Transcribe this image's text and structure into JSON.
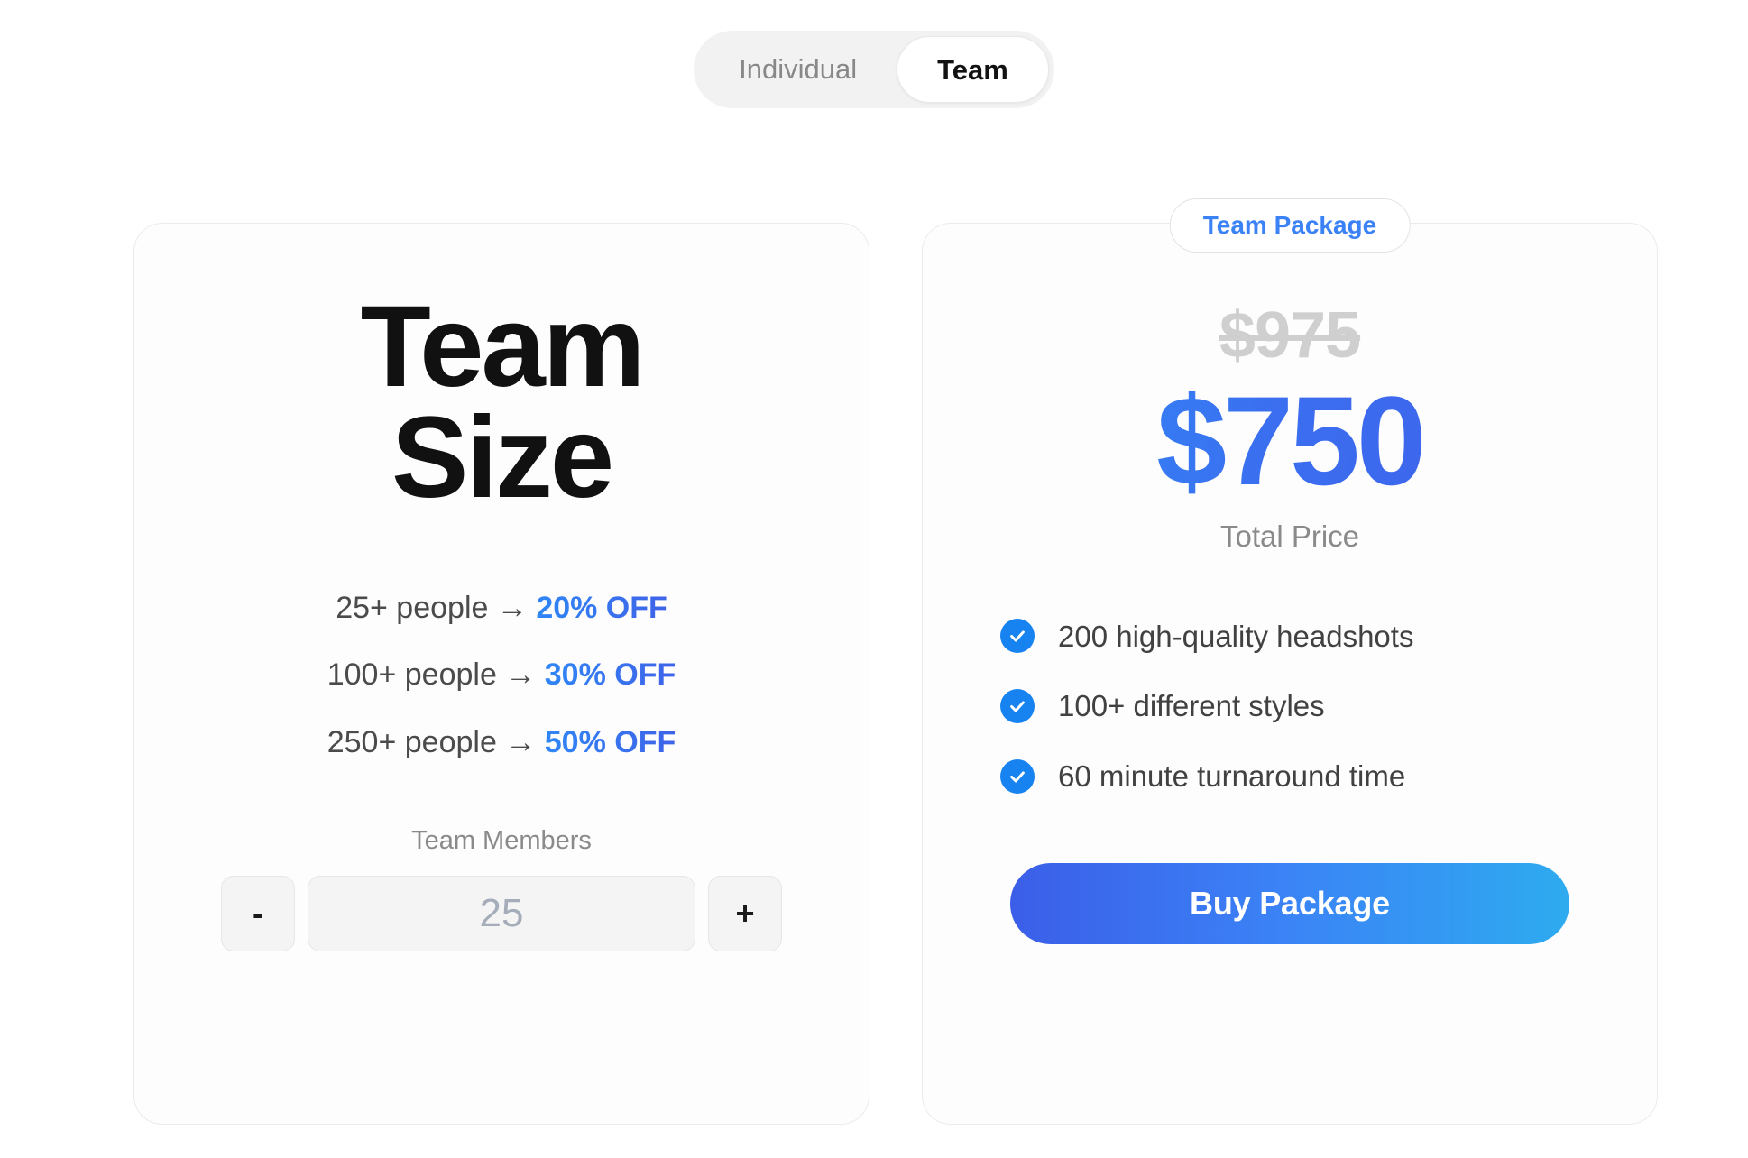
{
  "toggle": {
    "options": [
      {
        "label": "Individual",
        "selected": false
      },
      {
        "label": "Team",
        "selected": true
      }
    ]
  },
  "left_card": {
    "title_line1": "Team",
    "title_line2": "Size",
    "tiers": [
      {
        "people": "25+ people → ",
        "discount": "20% OFF"
      },
      {
        "people": "100+ people → ",
        "discount": "30% OFF"
      },
      {
        "people": "250+ people → ",
        "discount": "50% OFF"
      }
    ],
    "stepper": {
      "label": "Team Members",
      "decrement_label": "-",
      "increment_label": "+",
      "value": "25",
      "placeholder": "25"
    }
  },
  "right_card": {
    "badge": "Team Package",
    "original_price": "$975",
    "price": "$750",
    "price_caption": "Total Price",
    "features": [
      "200 high-quality headshots",
      "100+ different styles",
      "60 minute turnaround time"
    ],
    "cta_label": "Buy Package"
  },
  "colors": {
    "accent_blue": "#3b82f6",
    "accent_indigo": "#3b5ee8",
    "accent_cyan": "#2eabef",
    "check_blue": "#1683f0",
    "muted_text": "#8a8a8a",
    "body_text": "#414141",
    "strikethrough": "#cfcfcf",
    "card_border": "#ebebeb",
    "toggle_track": "#f2f2f2"
  }
}
